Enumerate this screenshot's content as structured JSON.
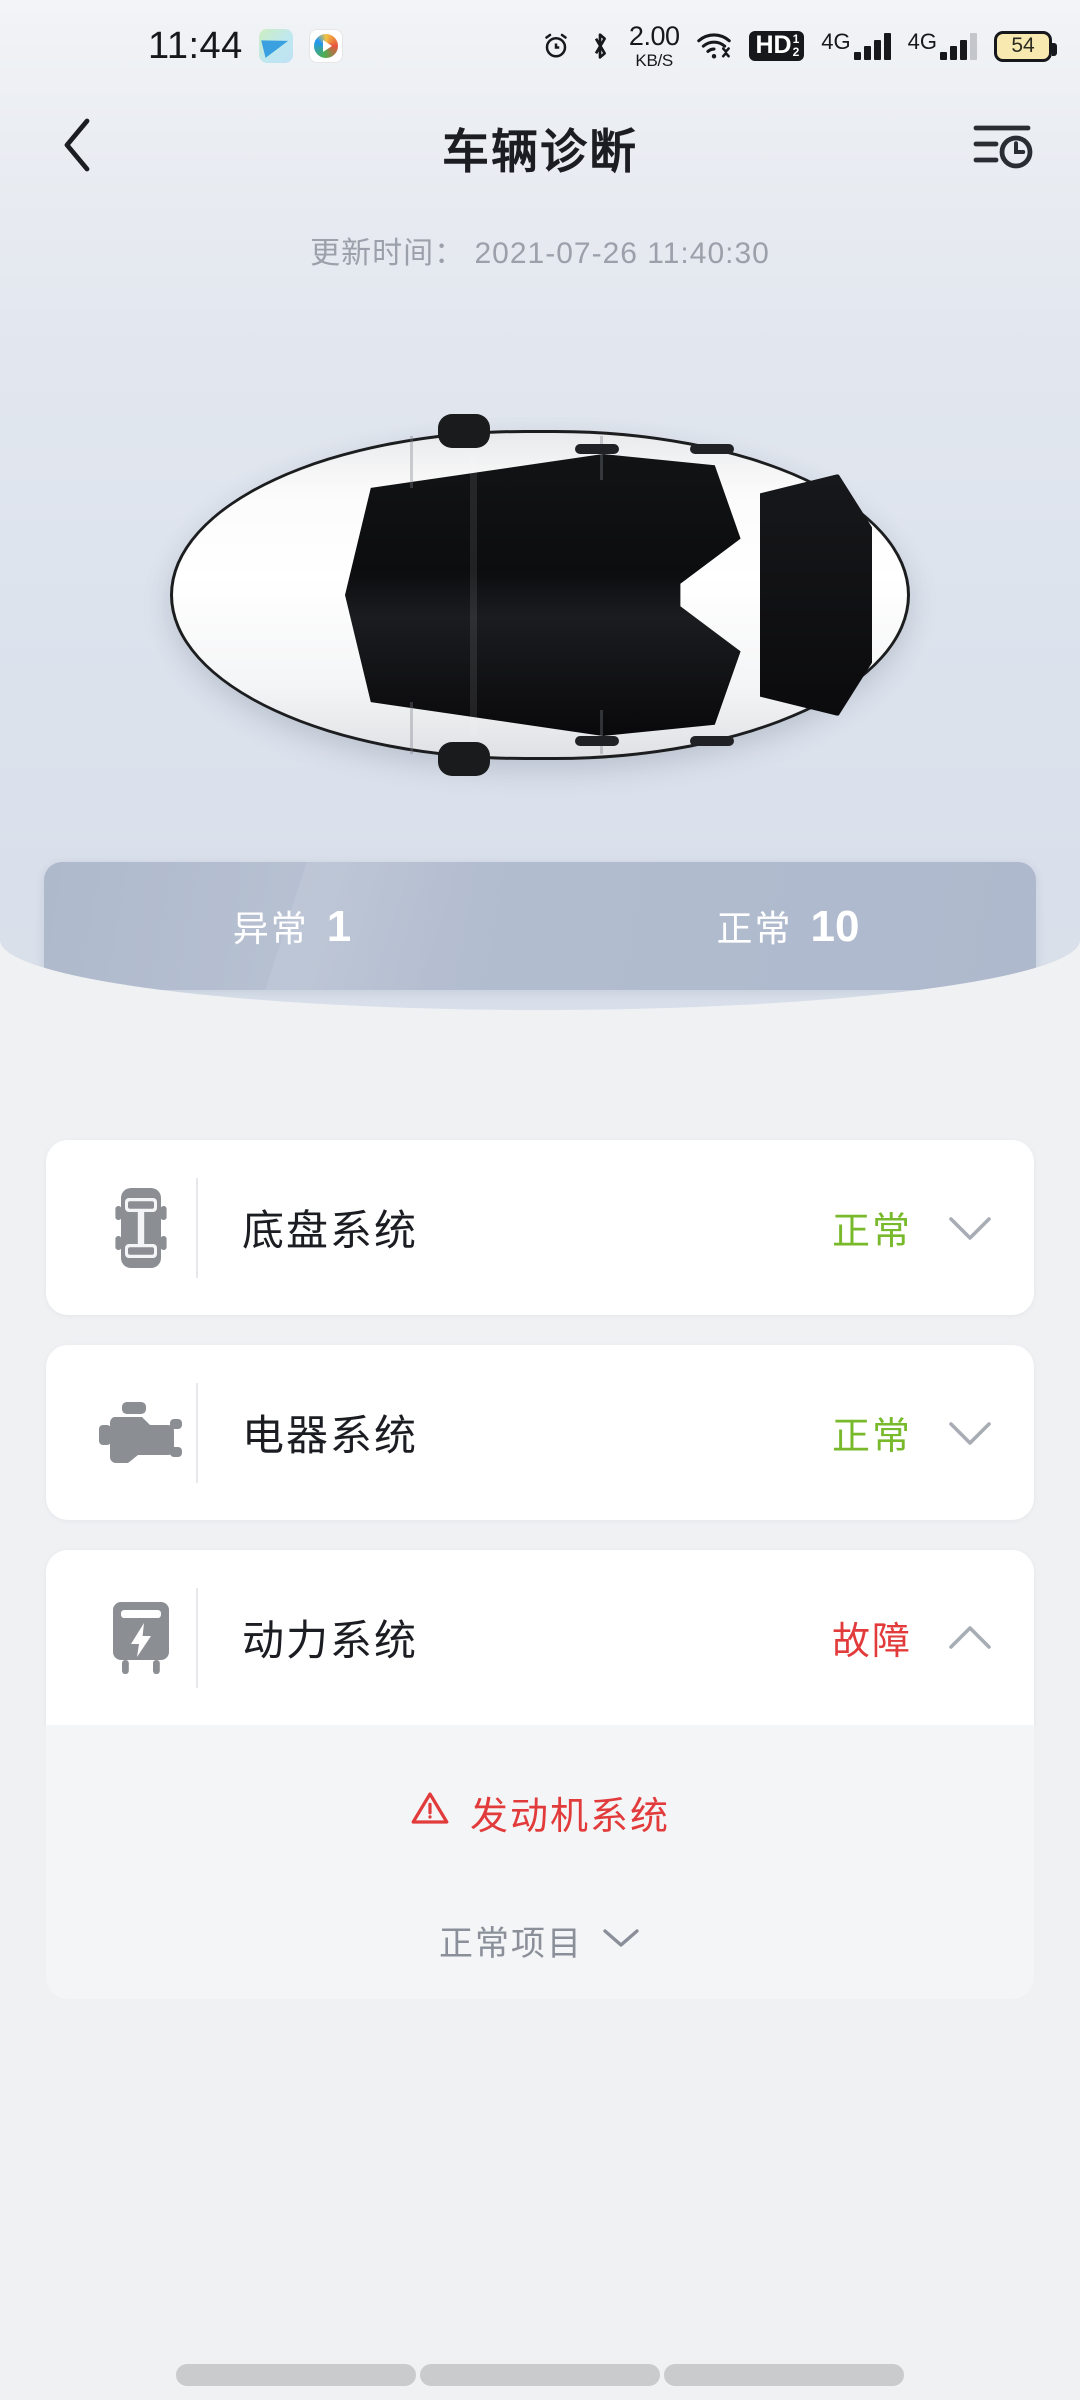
{
  "status_bar": {
    "time": "11:44",
    "app_icons": [
      "telegram-icon",
      "video-player-icon"
    ],
    "alarm_icon": "alarm-icon",
    "bluetooth_icon": "bluetooth-icon",
    "network_speed_value": "2.00",
    "network_speed_unit": "KB/S",
    "wifi_icon": "wifi-icon",
    "hd_badge": "HD",
    "hd_badge_sub_top": "1",
    "hd_badge_sub_bottom": "2",
    "sim1_label": "4G",
    "sim2_label": "4G",
    "battery_level": "54"
  },
  "header": {
    "back_icon": "chevron-left-icon",
    "title": "车辆诊断",
    "history_icon": "history-list-icon",
    "update_label": "更新时间：",
    "update_time": "2021-07-26 11:40:30",
    "update_line": "更新时间： 2021-07-26 11:40:30"
  },
  "vehicle": {
    "image_name": "car-top-view",
    "body_color": "#ffffff",
    "roof_color": "#101114"
  },
  "stats": {
    "abnormal_label": "异常",
    "abnormal_count": "1",
    "normal_label": "正常",
    "normal_count": "10"
  },
  "colors": {
    "ok": "#79ba2c",
    "fault": "#e23b3b",
    "stats_bar": "#b2bccf",
    "page_bg": "#f0f1f3"
  },
  "systems": [
    {
      "icon": "chassis-icon",
      "name": "底盘系统",
      "status": "正常",
      "state": "ok",
      "chevron": "chevron-down-icon",
      "expanded": false
    },
    {
      "icon": "engine-icon",
      "name": "电器系统",
      "status": "正常",
      "state": "ok",
      "chevron": "chevron-down-icon",
      "expanded": false
    },
    {
      "icon": "battery-power-icon",
      "name": "动力系统",
      "status": "故障",
      "state": "fault",
      "chevron": "chevron-up-icon",
      "expanded": true
    }
  ],
  "expanded_panel": {
    "warning_icon": "warning-triangle-icon",
    "fault_item": "发动机系统",
    "normal_items_label": "正常项目",
    "normal_items_chevron": "chevron-down-icon"
  },
  "nav_bar": {
    "segments": [
      "nav-back",
      "nav-home",
      "nav-recents"
    ]
  }
}
